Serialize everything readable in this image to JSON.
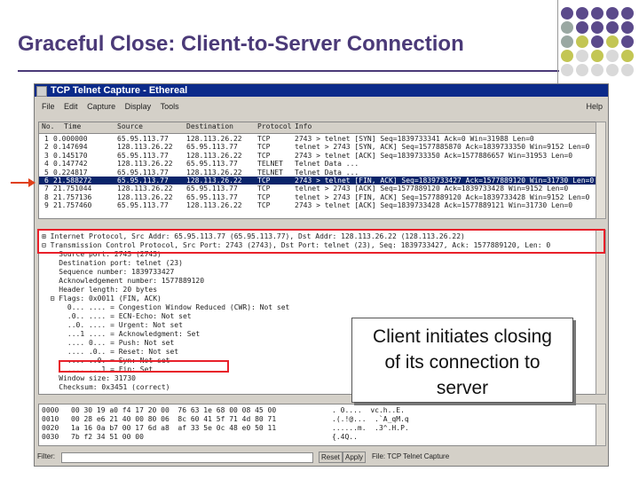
{
  "slide": {
    "title": "Graceful Close:  Client-to-Server Connection",
    "callout_line1": "Client initiates closing",
    "callout_line2": "of its connection to",
    "callout_line3": "server",
    "accent_color": "#4b3a78",
    "dot_colors": [
      "#5b4a8b",
      "#9aa8a2",
      "#c3c654",
      "#d9d9d9"
    ]
  },
  "window": {
    "title": "TCP Telnet Capture - Ethereal",
    "menu": [
      "File",
      "Edit",
      "Capture",
      "Display",
      "Tools"
    ],
    "help": "Help"
  },
  "packet_list": {
    "columns": [
      "No.",
      "Time",
      "Source",
      "Destination",
      "Protocol",
      "Info"
    ],
    "rows": [
      {
        "no": "1",
        "time": "0.000000",
        "src": "65.95.113.77",
        "dst": "128.113.26.22",
        "proto": "TCP",
        "info": "2743 > telnet [SYN] Seq=1839733341 Ack=0 Win=31988 Len=0"
      },
      {
        "no": "2",
        "time": "0.147694",
        "src": "128.113.26.22",
        "dst": "65.95.113.77",
        "proto": "TCP",
        "info": "telnet > 2743 [SYN, ACK] Seq=1577885870 Ack=1839733350 Win=9152 Len=0"
      },
      {
        "no": "3",
        "time": "0.145170",
        "src": "65.95.113.77",
        "dst": "128.113.26.22",
        "proto": "TCP",
        "info": "2743 > telnet [ACK] Seq=1839733350 Ack=1577886657 Win=31953 Len=0"
      },
      {
        "no": "4",
        "time": "0.147742",
        "src": "128.113.26.22",
        "dst": "65.95.113.77",
        "proto": "TELNET",
        "info": "Telnet Data ..."
      },
      {
        "no": "5",
        "time": "0.224817",
        "src": "65.95.113.77",
        "dst": "128.113.26.22",
        "proto": "TELNET",
        "info": "Telnet Data ..."
      },
      {
        "no": "6",
        "time": "21.588272",
        "src": "65.95.113.77",
        "dst": "128.113.26.22",
        "proto": "TCP",
        "info": "2743 > telnet [FIN, ACK] Seq=1839733427 Ack=1577889120 Win=31730 Len=0"
      },
      {
        "no": "7",
        "time": "21.751044",
        "src": "128.113.26.22",
        "dst": "65.95.113.77",
        "proto": "TCP",
        "info": "telnet > 2743 [ACK] Seq=1577889120 Ack=1839733428 Win=9152 Len=0"
      },
      {
        "no": "8",
        "time": "21.757136",
        "src": "128.113.26.22",
        "dst": "65.95.113.77",
        "proto": "TCP",
        "info": "telnet > 2743 [FIN, ACK] Seq=1577889120 Ack=1839733428 Win=9152 Len=0"
      },
      {
        "no": "9",
        "time": "21.757460",
        "src": "65.95.113.77",
        "dst": "128.113.26.22",
        "proto": "TCP",
        "info": "2743 > telnet [ACK] Seq=1839733428 Ack=1577889121 Win=31730 Len=0"
      }
    ],
    "selected_index": 5
  },
  "details": {
    "lines": [
      "⊞ Internet Protocol, Src Addr: 65.95.113.77 (65.95.113.77), Dst Addr: 128.113.26.22 (128.113.26.22)",
      "⊟ Transmission Control Protocol, Src Port: 2743 (2743), Dst Port: telnet (23), Seq: 1839733427, Ack: 1577889120, Len: 0",
      "    Source port: 2743 (2743)",
      "    Destination port: telnet (23)",
      "    Sequence number: 1839733427",
      "    Acknowledgement number: 1577889120",
      "    Header length: 20 bytes",
      "  ⊟ Flags: 0x0011 (FIN, ACK)",
      "      0... .... = Congestion Window Reduced (CWR): Not set",
      "      .0.. .... = ECN-Echo: Not set",
      "      ..0. .... = Urgent: Not set",
      "      ...1 .... = Acknowledgment: Set",
      "      .... 0... = Push: Not set",
      "      .... .0.. = Reset: Not set",
      "      .... ..0. = Syn: Not set",
      "      .... ...1 = Fin: Set",
      "    Window size: 31730",
      "    Checksum: 0x3451 (correct)"
    ]
  },
  "hex": {
    "rows": [
      {
        "off": "0000",
        "hex": "00 30 19 a0 f4 17 20 00  76 63 1e 68 00 08 45 00",
        "ascii": ". 0....  vc.h..E."
      },
      {
        "off": "0010",
        "hex": "00 28 e6 21 40 00 80 06  8c 60 41 5f 71 4d 80 71",
        "ascii": ".(.!@...  .`A_qM.q"
      },
      {
        "off": "0020",
        "hex": "1a 16 0a b7 00 17 6d a8  af 33 5e 0c 48 e0 50 11",
        "ascii": "......m.  .3^.H.P."
      },
      {
        "off": "0030",
        "hex": "7b f2 34 51 00 00",
        "ascii": "{.4Q.."
      }
    ]
  },
  "statusbar": {
    "filter_label": "Filter:",
    "reset": "Reset",
    "apply": "Apply",
    "file": "File: TCP Telnet Capture"
  }
}
